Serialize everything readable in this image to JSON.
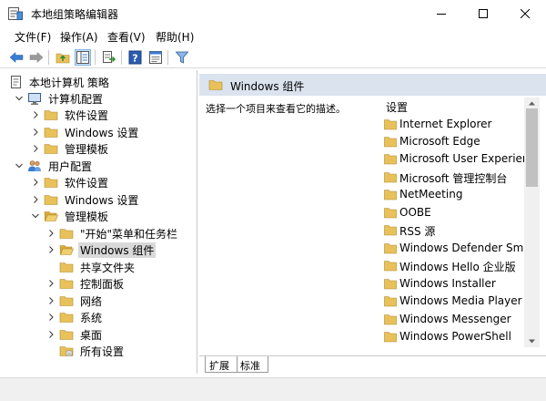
{
  "window": {
    "title": "本地组策略编辑器",
    "controls": {
      "minimize": "minimize",
      "maximize": "maximize",
      "close": "close"
    }
  },
  "menubar": {
    "items": [
      {
        "label": "文件(F)"
      },
      {
        "label": "操作(A)"
      },
      {
        "label": "查看(V)"
      },
      {
        "label": "帮助(H)"
      }
    ]
  },
  "toolbar": {
    "icons": [
      "back-arrow-icon",
      "forward-arrow-icon",
      "folder-up-icon",
      "show-hide-tree-icon",
      "export-list-icon",
      "help-icon",
      "properties-icon",
      "filter-icon"
    ]
  },
  "tree": {
    "root": "本地计算机 策略",
    "computer_config": "计算机配置",
    "computer_children": [
      "软件设置",
      "Windows 设置",
      "管理模板"
    ],
    "user_config": "用户配置",
    "user_children": [
      "软件设置",
      "Windows 设置",
      "管理模板"
    ],
    "admin_templates_children": [
      "\"开始\"菜单和任务栏",
      "Windows 组件",
      "共享文件夹",
      "控制面板",
      "网络",
      "系统",
      "桌面",
      "所有设置"
    ],
    "selected": "Windows 组件"
  },
  "right_pane": {
    "header": "Windows 组件",
    "description": "选择一个项目来查看它的描述。",
    "column_header": "设置",
    "items": [
      "Internet Explorer",
      "Microsoft Edge",
      "Microsoft User Experience Virtualization",
      "Microsoft 管理控制台",
      "NetMeeting",
      "OOBE",
      "RSS 源",
      "Windows Defender SmartScreen",
      "Windows Hello 企业版",
      "Windows Installer",
      "Windows Media Player",
      "Windows Messenger",
      "Windows PowerShell"
    ]
  },
  "tabs": [
    {
      "label": "扩展"
    },
    {
      "label": "标准"
    }
  ],
  "colors": {
    "header_bg": "#dae3ee",
    "folder": "#e8c15a",
    "selection": "#d9d9d9",
    "toolbar_active": "#cce4f7"
  }
}
